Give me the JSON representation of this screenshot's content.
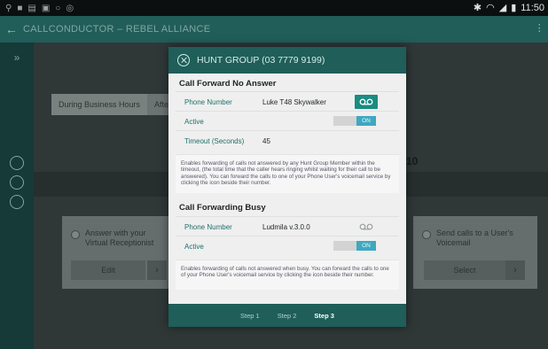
{
  "status_bar": {
    "time": "11:50",
    "left_icons": [
      "location-icon",
      "image-icon",
      "notes-icon",
      "mail-icon",
      "circle-icon",
      "headset-icon"
    ],
    "right_icons": [
      "bluetooth-icon",
      "wifi-icon",
      "signal-icon",
      "battery-icon"
    ]
  },
  "app_bar": {
    "breadcrumb": "CALLCONDUCTOR  –  REBEL ALLIANCE"
  },
  "background": {
    "tabs": [
      "During Business Hours",
      "After H"
    ],
    "count": "10",
    "cards": [
      {
        "label": "Answer with your Virtual Receptionist",
        "button": "Edit"
      },
      {
        "label": "Send calls to a User's Voicemail",
        "button": "Select"
      }
    ]
  },
  "modal": {
    "title": "HUNT GROUP (03 7779 9199)",
    "no_answer": {
      "heading": "Call Forward No Answer",
      "phone_label": "Phone Number",
      "phone_value": "Luke T48 Skywalker",
      "active_label": "Active",
      "active_state": "ON",
      "timeout_label": "Timeout (Seconds)",
      "timeout_value": "45",
      "note": "Enables forwarding of calls not answered by any Hunt Group Member within the timeout, (the total time that the caller hears ringing whilst waiting for their call to be answered). You can forward the calls to one of your Phone User's voicemail service by clicking the icon beside their number."
    },
    "busy": {
      "heading": "Call Forwarding Busy",
      "phone_label": "Phone Number",
      "phone_value": "Ludmila v.3.0.0",
      "active_label": "Active",
      "active_state": "ON",
      "note": "Enables forwarding of calls not answered when busy. You can forward the calls to one of your Phone User's voicemail service by clicking the icon beside their number."
    },
    "steps": [
      "Step 1",
      "Step 2",
      "Step 3"
    ],
    "current_step": "Step 3"
  },
  "colors": {
    "teal_header": "#1f5e59",
    "voicemail_button": "#1a8c82",
    "toggle_on": "#3fa8c0"
  }
}
